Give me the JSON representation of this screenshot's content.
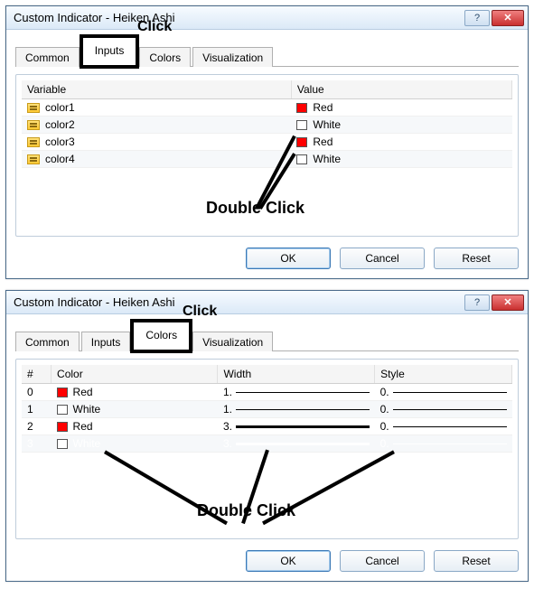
{
  "dialog1": {
    "title": "Custom Indicator - Heiken Ashi",
    "tabs": {
      "common": "Common",
      "inputs": "Inputs",
      "colors": "Colors",
      "visualization": "Visualization"
    },
    "columns": {
      "variable": "Variable",
      "value": "Value"
    },
    "rows": [
      {
        "var": "color1",
        "value": "Red",
        "swatch": "sw-red"
      },
      {
        "var": "color2",
        "value": "White",
        "swatch": "sw-white"
      },
      {
        "var": "color3",
        "value": "Red",
        "swatch": "sw-red"
      },
      {
        "var": "color4",
        "value": "White",
        "swatch": "sw-white"
      }
    ],
    "buttons": {
      "ok": "OK",
      "cancel": "Cancel",
      "reset": "Reset"
    },
    "annot_click": "Click",
    "annot_double": "Double Click"
  },
  "dialog2": {
    "title": "Custom Indicator - Heiken Ashi",
    "tabs": {
      "common": "Common",
      "inputs": "Inputs",
      "colors": "Colors",
      "visualization": "Visualization"
    },
    "columns": {
      "idx": "#",
      "color": "Color",
      "width": "Width",
      "style": "Style"
    },
    "rows": [
      {
        "idx": "0",
        "color": "Red",
        "swatch": "sw-red",
        "width": "1.",
        "wclass": "w1",
        "style": "0."
      },
      {
        "idx": "1",
        "color": "White",
        "swatch": "sw-white",
        "width": "1.",
        "wclass": "w1",
        "style": "0."
      },
      {
        "idx": "2",
        "color": "Red",
        "swatch": "sw-red",
        "width": "3.",
        "wclass": "w3",
        "style": "0."
      },
      {
        "idx": "3",
        "color": "White",
        "swatch": "sw-white",
        "width": "3.",
        "wclass": "w3",
        "style": "0.",
        "selected": true
      }
    ],
    "buttons": {
      "ok": "OK",
      "cancel": "Cancel",
      "reset": "Reset"
    },
    "annot_click": "Click",
    "annot_double": "Double Click"
  }
}
